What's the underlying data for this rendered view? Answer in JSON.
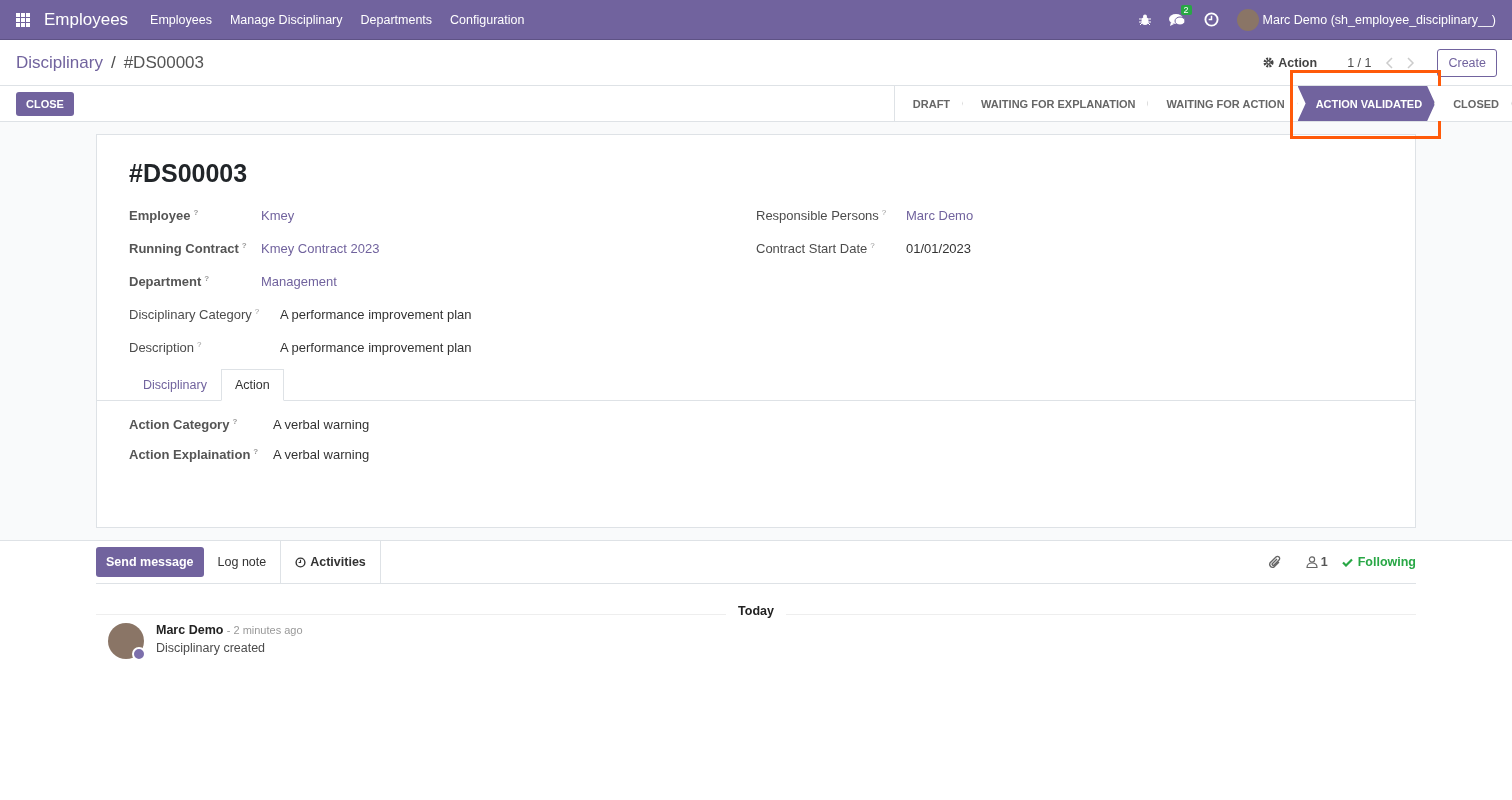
{
  "navbar": {
    "app_title": "Employees",
    "menu": [
      "Employees",
      "Manage Disciplinary",
      "Departments",
      "Configuration"
    ],
    "message_count": "2",
    "user": "Marc Demo (sh_employee_disciplinary__)"
  },
  "breadcrumb": {
    "parent": "Disciplinary",
    "separator": "/",
    "current": "#DS00003"
  },
  "control_panel": {
    "action": "Action",
    "pager": "1 / 1",
    "create": "Create"
  },
  "status_bar": {
    "button": "CLOSE",
    "stages": [
      {
        "label": "DRAFT",
        "selected": false
      },
      {
        "label": "WAITING FOR EXPLANATION",
        "selected": false
      },
      {
        "label": "WAITING FOR ACTION",
        "selected": false
      },
      {
        "label": "ACTION VALIDATED",
        "selected": true
      },
      {
        "label": "CLOSED",
        "selected": false
      }
    ]
  },
  "form": {
    "title": "#DS00003",
    "left_fields": [
      {
        "label": "Employee",
        "help": "?",
        "required": true,
        "kind": "link",
        "value": "Kmey"
      },
      {
        "label": "Running Contract",
        "help": "?",
        "required": true,
        "kind": "link",
        "value": "Kmey Contract 2023"
      },
      {
        "label": "Department",
        "help": "?",
        "required": true,
        "kind": "link",
        "value": "Management"
      },
      {
        "label": "Disciplinary Category",
        "help": "?",
        "required": false,
        "kind": "text",
        "value": "A performance improvement plan"
      },
      {
        "label": "Description",
        "help": "?",
        "required": false,
        "kind": "text",
        "value": "A performance improvement plan"
      }
    ],
    "right_fields": [
      {
        "label": "Responsible Persons",
        "help": "?",
        "required": false,
        "kind": "link",
        "value": "Marc Demo"
      },
      {
        "label": "Contract Start Date",
        "help": "?",
        "required": false,
        "kind": "text",
        "value": "01/01/2023"
      }
    ],
    "tabs": [
      {
        "label": "Disciplinary",
        "selected": false
      },
      {
        "label": "Action",
        "selected": true
      }
    ],
    "tab_fields": [
      {
        "label": "Action Category",
        "help": "?",
        "required": true,
        "value": "A verbal warning"
      },
      {
        "label": "Action Explaination",
        "help": "?",
        "required": true,
        "value": "A verbal warning"
      }
    ]
  },
  "chatter": {
    "send_message": "Send message",
    "log_note": "Log note",
    "activities": "Activities",
    "followers": "1",
    "following": "Following",
    "date_separator": "Today",
    "messages": [
      {
        "author": "Marc Demo",
        "time": "- 2 minutes ago",
        "body": "Disciplinary created"
      }
    ]
  }
}
